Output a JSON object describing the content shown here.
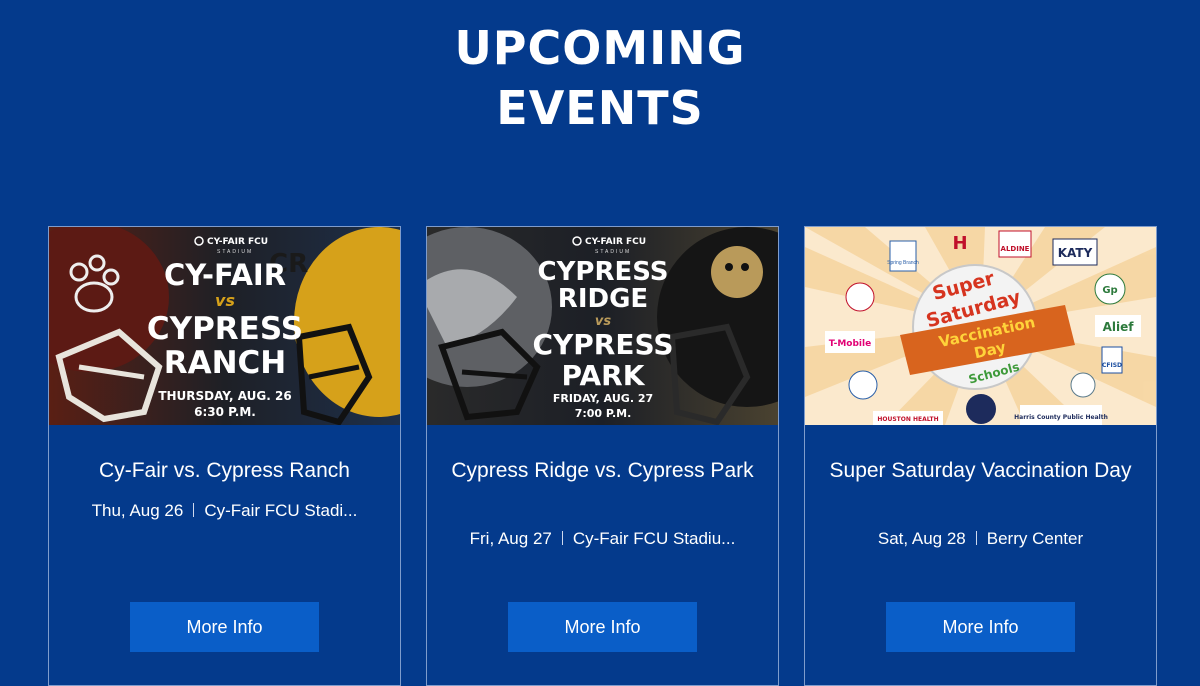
{
  "header": {
    "title_line1": "UPCOMING",
    "title_line2": "EVENTS"
  },
  "events": [
    {
      "title": "Cy-Fair vs. Cypress Ranch",
      "date": "Thu, Aug 26",
      "venue": "Cy-Fair FCU Stadi...",
      "button": "More Info",
      "graphic": {
        "brand": "CY-FAIR FCU",
        "brand_sub": "STADIUM",
        "team1": "CY-FAIR",
        "vs": "vs",
        "team2_line1": "CYPRESS",
        "team2_line2": "RANCH",
        "date": "THURSDAY, AUG. 26",
        "time": "6:30 P.M.",
        "helmet_logo": "CR"
      }
    },
    {
      "title": "Cypress Ridge vs. Cypress Park",
      "date": "Fri, Aug 27",
      "venue": "Cy-Fair FCU Stadiu...",
      "button": "More Info",
      "graphic": {
        "brand": "CY-FAIR FCU",
        "brand_sub": "STADIUM",
        "team1_line1": "CYPRESS",
        "team1_line2": "RIDGE",
        "vs": "vs",
        "team2_line1": "CYPRESS",
        "team2_line2": "PARK",
        "date": "FRIDAY, AUG. 27",
        "time": "7:00 P.M."
      }
    },
    {
      "title": "Super Saturday Vaccination Day",
      "date": "Sat, Aug 28",
      "venue": "Berry Center",
      "button": "More Info",
      "graphic": {
        "line1": "Super",
        "line2": "Saturday",
        "banner1": "Vaccination",
        "banner2": "Day",
        "schools": "Schools",
        "logos": [
          "Spring Branch",
          "H",
          "ALDINE",
          "KATY",
          "Gp",
          "Alief",
          "CFISD",
          "T-Mobile",
          "HOUSTON HEALTH",
          "Harris County Public Health"
        ]
      }
    }
  ]
}
